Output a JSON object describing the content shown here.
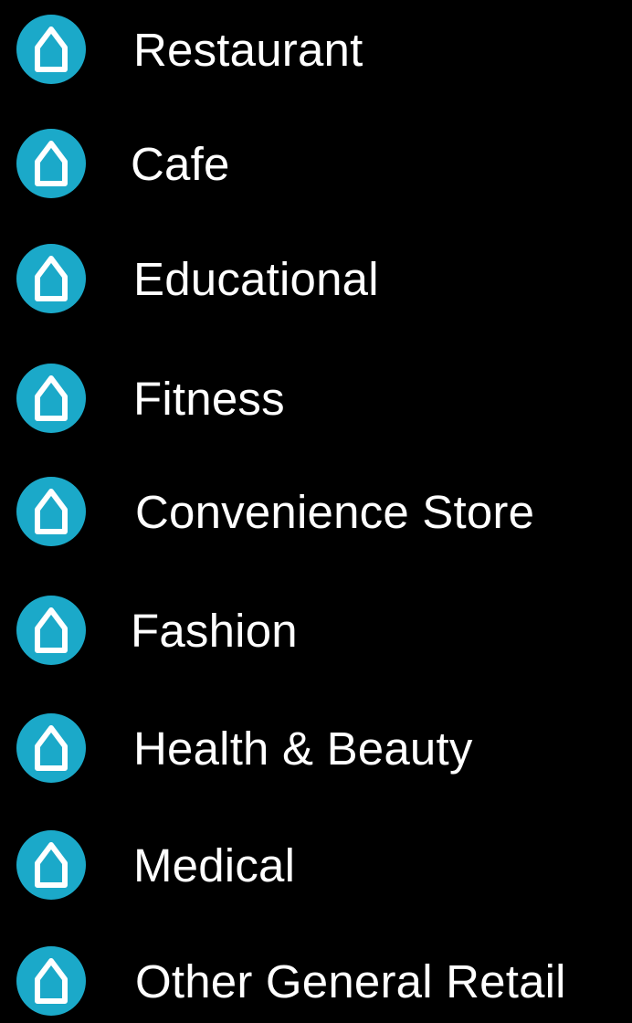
{
  "colors": {
    "background": "#000000",
    "icon_fill": "#1ba9c9",
    "icon_glyph": "#ffffff",
    "text": "#ffffff"
  },
  "icon": "house-outline-icon",
  "categories": [
    {
      "label": "Restaurant"
    },
    {
      "label": "Cafe"
    },
    {
      "label": "Educational"
    },
    {
      "label": "Fitness"
    },
    {
      "label": "Convenience Store"
    },
    {
      "label": "Fashion"
    },
    {
      "label": "Health & Beauty"
    },
    {
      "label": "Medical"
    },
    {
      "label": "Other General Retail"
    }
  ]
}
